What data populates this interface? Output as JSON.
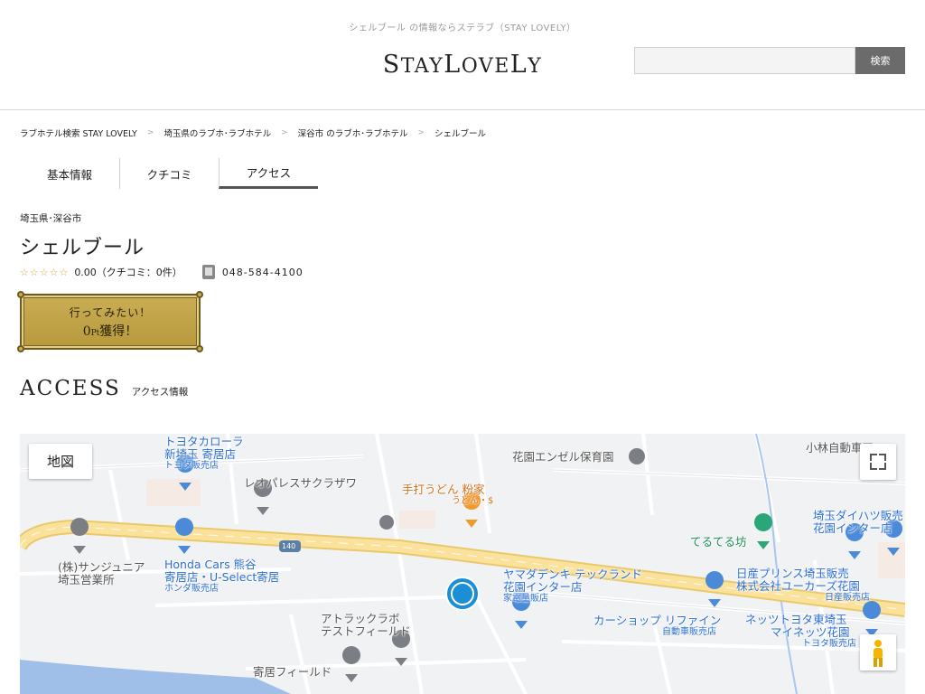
{
  "header": {
    "tagline": "シェルブール の情報ならステラブ（STAY LOVELY）",
    "logo_text": "STAYLOVELY",
    "search_placeholder": "",
    "search_button": "検索"
  },
  "breadcrumb": [
    "ラブホテル検索 STAY LOVELY",
    "埼玉県のラブホ･ラブホテル",
    "深谷市 のラブホ･ラブホテル",
    "シェルブール"
  ],
  "breadcrumb_separator": ">",
  "tabs": [
    {
      "label": "基本情報",
      "active": false
    },
    {
      "label": "クチコミ",
      "active": false
    },
    {
      "label": "アクセス",
      "active": true
    }
  ],
  "hotel": {
    "area": "埼玉県･深谷市",
    "name": "シェルブール",
    "stars": "☆☆☆☆☆",
    "rating_text": "0.00（クチコミ：0件）",
    "phone": "048-584-4100"
  },
  "want_button": {
    "line1": "行ってみたい！",
    "points": "0",
    "unit": "Pt",
    "suffix": "獲得！"
  },
  "access": {
    "title": "ACCESS",
    "subtitle": "アクセス情報"
  },
  "map": {
    "type_button": "地図",
    "road_number": "140",
    "pois": [
      {
        "id": "toyota-corolla",
        "lines": [
          "トヨタカローラ",
          "新埼玉 寄居店"
        ],
        "sub": "トヨタ販売店",
        "color": "blue"
      },
      {
        "id": "leopalace",
        "lines": [
          "レオパレスサクラザワ"
        ],
        "sub": "",
        "color": "grey"
      },
      {
        "id": "udon",
        "lines": [
          "手打うどん 粉家"
        ],
        "sub": "うどん・$",
        "color": "orange"
      },
      {
        "id": "nursery",
        "lines": [
          "花園エンゼル保育園"
        ],
        "sub": "",
        "color": "grey"
      },
      {
        "id": "kobayashi",
        "lines": [
          "小林自動車工"
        ],
        "sub": "",
        "color": "grey"
      },
      {
        "id": "daihatsu",
        "lines": [
          "埼玉ダイハツ販売",
          "花園インター店"
        ],
        "sub": "",
        "color": "blue"
      },
      {
        "id": "teruterubo",
        "lines": [
          "てるてる坊"
        ],
        "sub": "",
        "color": "green"
      },
      {
        "id": "sunjunior",
        "lines": [
          "(株)サンジュニア",
          "埼玉営業所"
        ],
        "sub": "",
        "color": "grey"
      },
      {
        "id": "honda",
        "lines": [
          "Honda Cars 熊谷",
          "寄居店・U-Select寄居"
        ],
        "sub": "ホンダ販売店",
        "color": "blue"
      },
      {
        "id": "yamada",
        "lines": [
          "ヤマダデンキ テックランド",
          "花園インター店"
        ],
        "sub": "家電量販店",
        "color": "blue"
      },
      {
        "id": "nissan",
        "lines": [
          "日産プリンス埼玉販売",
          "株式会社ユーカーズ花園"
        ],
        "sub": "日産販売店",
        "color": "blue"
      },
      {
        "id": "atrack",
        "lines": [
          "アトラックラボ",
          "テストフィールド"
        ],
        "sub": "",
        "color": "grey"
      },
      {
        "id": "carshop",
        "lines": [
          "カーショップ リファイン"
        ],
        "sub": "自動車販売店",
        "color": "blue"
      },
      {
        "id": "netz",
        "lines": [
          "ネッツトヨタ東埼玉",
          "マイネッツ花園"
        ],
        "sub": "トヨタ販売店",
        "color": "blue"
      },
      {
        "id": "yorii-field",
        "lines": [
          "寄居フィールド"
        ],
        "sub": "",
        "color": "grey"
      }
    ]
  }
}
